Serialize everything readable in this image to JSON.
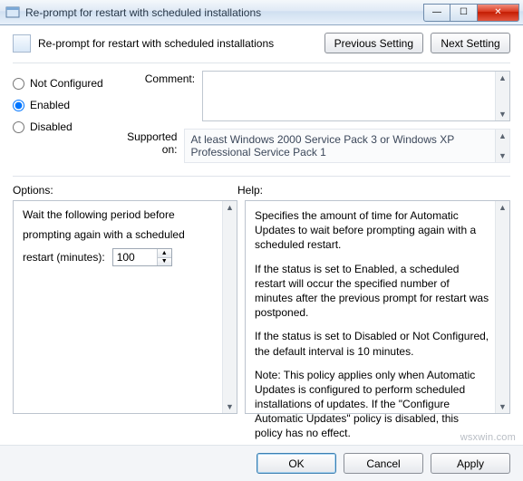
{
  "window": {
    "title": "Re-prompt for restart with scheduled installations",
    "min_label": "—",
    "max_label": "☐",
    "close_label": "✕"
  },
  "header": {
    "subtitle": "Re-prompt for restart with scheduled installations",
    "prev_btn": "Previous Setting",
    "next_btn": "Next Setting"
  },
  "state": {
    "radios": {
      "not_configured": "Not Configured",
      "enabled": "Enabled",
      "disabled": "Disabled",
      "selected": "enabled"
    },
    "comment_label": "Comment:",
    "comment_value": "",
    "supported_label": "Supported on:",
    "supported_value": "At least Windows 2000 Service Pack 3 or Windows XP Professional Service Pack 1"
  },
  "labels": {
    "options": "Options:",
    "help": "Help:"
  },
  "options": {
    "line1": "Wait the following period before",
    "line2": "prompting again with a scheduled",
    "restart_label": "restart (minutes):",
    "restart_value": "100"
  },
  "help": {
    "p1": "Specifies the amount of time for Automatic Updates to wait before prompting again with a scheduled restart.",
    "p2": "If the status is set to Enabled, a scheduled restart will occur the specified number of minutes after the previous prompt for restart was postponed.",
    "p3": "If the status is set to Disabled or Not Configured, the default interval is 10 minutes.",
    "p4": "Note: This policy applies only when Automatic Updates is configured to perform scheduled installations of updates. If the \"Configure Automatic Updates\" policy is disabled, this policy has no effect."
  },
  "footer": {
    "ok": "OK",
    "cancel": "Cancel",
    "apply": "Apply"
  },
  "watermark": "wsxwin.com"
}
